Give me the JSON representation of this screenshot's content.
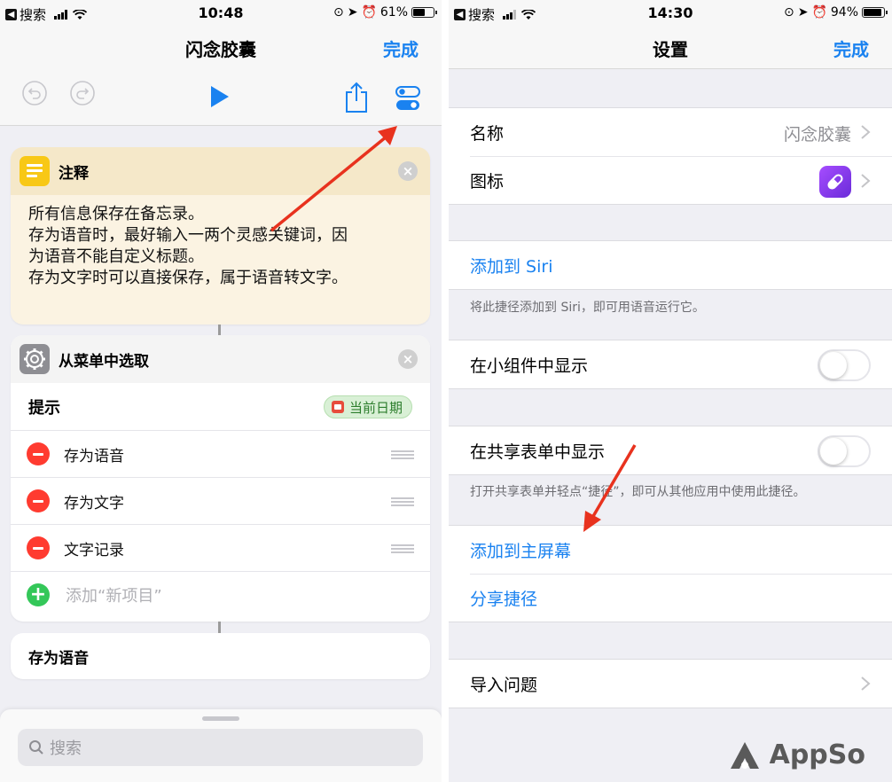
{
  "left": {
    "status": {
      "carrier": "搜索",
      "time": "10:48",
      "battery": "61%",
      "battery_level": 0.61
    },
    "nav": {
      "title": "闪念胶囊",
      "done": "完成"
    },
    "note_card": {
      "title": "注释",
      "lines": [
        "所有信息保存在备忘录。",
        "存为语音时，最好输入一两个灵感关键词，因",
        "为语音不能自定义标题。",
        "存为文字时可以直接保存，属于语音转文字。"
      ]
    },
    "menu_card": {
      "title": "从菜单中选取",
      "prompt_label": "提示",
      "prompt_chip": "当前日期",
      "items": [
        "存为语音",
        "存为文字",
        "文字记录"
      ],
      "add_item": "添加“新项目”"
    },
    "next_card": {
      "title": "存为语音"
    },
    "search": {
      "placeholder": "搜索"
    }
  },
  "right": {
    "status": {
      "carrier": "搜索",
      "time": "14:30",
      "battery": "94%",
      "battery_level": 0.94
    },
    "nav": {
      "title": "设置",
      "done": "完成"
    },
    "name_label": "名称",
    "name_value": "闪念胶囊",
    "icon_label": "图标",
    "siri_label": "添加到 Siri",
    "siri_note": "将此捷径添加到 Siri，即可用语音运行它。",
    "widget_label": "在小组件中显示",
    "share_sheet_label": "在共享表单中显示",
    "share_sheet_note": "打开共享表单并轻点“捷径”，即可从其他应用中使用此捷径。",
    "home_label": "添加到主屏幕",
    "share_label": "分享捷径",
    "import_label": "导入问题"
  },
  "watermark": "AppSo",
  "colors": {
    "accent": "#1a82f0",
    "destructive": "#ff3b30",
    "add": "#34c759",
    "note": "#f8c816",
    "arrow": "#e8321e"
  }
}
